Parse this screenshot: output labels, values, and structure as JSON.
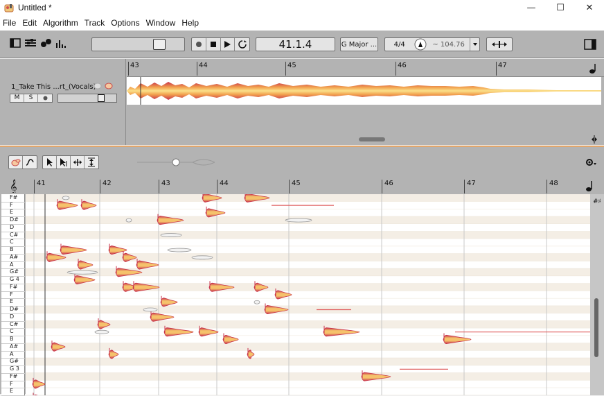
{
  "window": {
    "title": "Untitled *",
    "minimize": "—",
    "maximize": "☐",
    "close": "✕"
  },
  "menu": [
    "File",
    "Edit",
    "Algorithm",
    "Track",
    "Options",
    "Window",
    "Help"
  ],
  "toolbar": {
    "position": "41.1.4",
    "key": "G Major ...",
    "time_signature": "4/4",
    "tempo": "~ 104.76"
  },
  "track": {
    "name": "1_Take This ...rt_(Vocals)",
    "mute": "M",
    "solo": "S",
    "bars": [
      "43",
      "44",
      "45",
      "46",
      "47"
    ]
  },
  "editor": {
    "bars": [
      "41",
      "42",
      "43",
      "44",
      "45",
      "46",
      "47",
      "48"
    ],
    "pitches": [
      "F#",
      "F",
      "E",
      "D#",
      "D",
      "C#",
      "C",
      "B",
      "A#",
      "A",
      "G#",
      "G 4",
      "F#",
      "F",
      "E",
      "D#",
      "D",
      "C#",
      "C",
      "B",
      "A#",
      "A",
      "G#",
      "G 3",
      "F#",
      "F",
      "E"
    ]
  },
  "colors": {
    "blob_fill": "#f5c26b",
    "blob_edge": "#c8324a",
    "pitch_line": "#e06060",
    "accent_border": "#e2a66a"
  }
}
